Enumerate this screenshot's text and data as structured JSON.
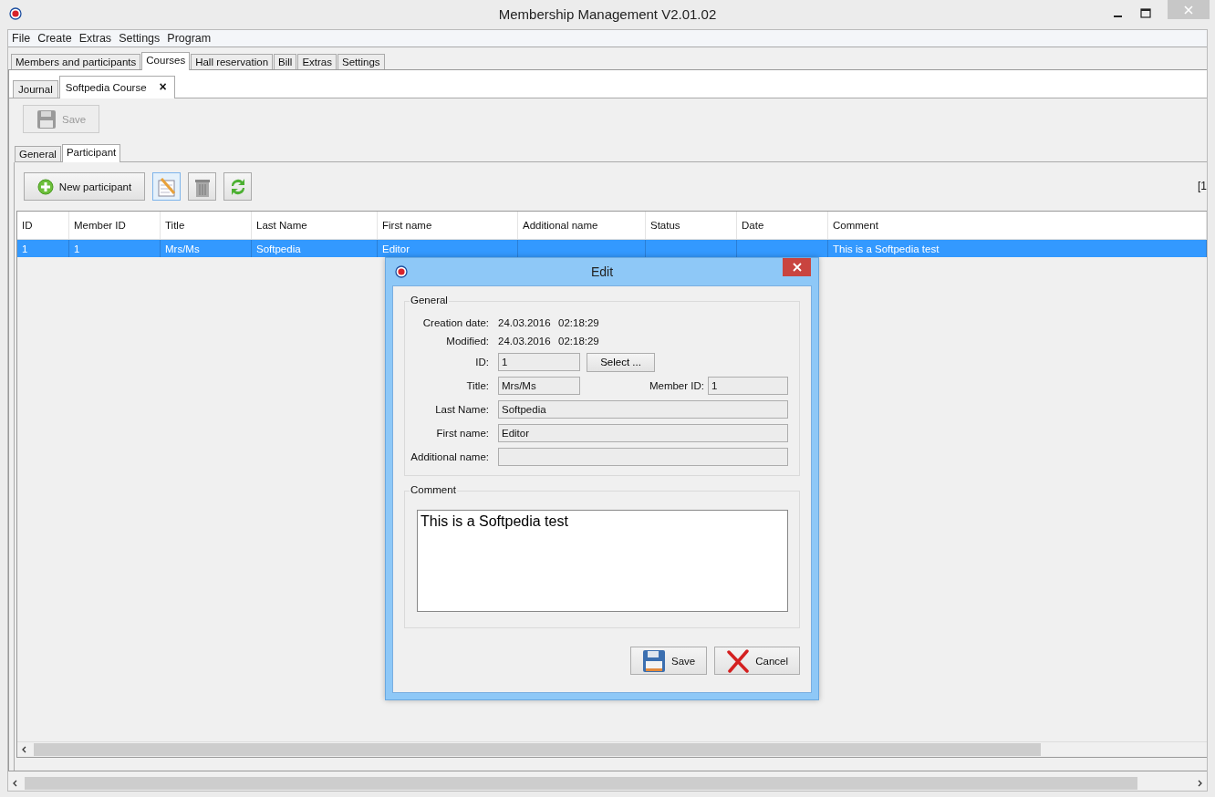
{
  "window": {
    "title": "Membership Management V2.01.02"
  },
  "menu": [
    "File",
    "Create",
    "Extras",
    "Settings",
    "Program"
  ],
  "main_tabs": [
    {
      "label": "Members and participants",
      "selected": false
    },
    {
      "label": "Courses",
      "selected": true
    },
    {
      "label": "Hall reservation",
      "selected": false
    },
    {
      "label": "Bill",
      "selected": false
    },
    {
      "label": "Extras",
      "selected": false
    },
    {
      "label": "Settings",
      "selected": false
    }
  ],
  "sub_tabs": [
    {
      "label": "Journal",
      "selected": false
    },
    {
      "label": "Softpedia Course",
      "selected": true,
      "close": "×"
    }
  ],
  "save_button": {
    "label": "Save",
    "disabled": true
  },
  "inner_tabs": [
    {
      "label": "General",
      "selected": false
    },
    {
      "label": "Participant",
      "selected": true
    }
  ],
  "toolbar": {
    "new_button": "New participant",
    "page_indicator": "[1"
  },
  "table": {
    "columns": [
      "ID",
      "Member ID",
      "Title",
      "Last Name",
      "First name",
      "Additional name",
      "Status",
      "Date",
      "Comment"
    ],
    "rows": [
      {
        "selected": true,
        "cells": [
          "1",
          "1",
          "Mrs/Ms",
          "Softpedia",
          "Editor",
          null,
          null,
          null,
          "This is a Softpedia test"
        ]
      }
    ]
  },
  "dialog": {
    "title": "Edit",
    "general_legend": "General",
    "creation_label": "Creation date:",
    "creation_date": "24.03.2016",
    "creation_time": "02:18:29",
    "modified_label": "Modified:",
    "modified_date": "24.03.2016",
    "modified_time": "02:18:29",
    "id_label": "ID:",
    "id_value": "1",
    "select_button": "Select ...",
    "title_label": "Title:",
    "title_value": "Mrs/Ms",
    "member_id_label": "Member ID:",
    "member_id_value": "1",
    "fields": [
      {
        "label": "Last Name:",
        "value": "Softpedia"
      },
      {
        "label": "First name:",
        "value": "Editor"
      },
      {
        "label": "Additional name:"
      }
    ],
    "comment_legend": "Comment",
    "comment": "This is a Softpedia test",
    "save_button": "Save",
    "cancel_button": "Cancel"
  }
}
